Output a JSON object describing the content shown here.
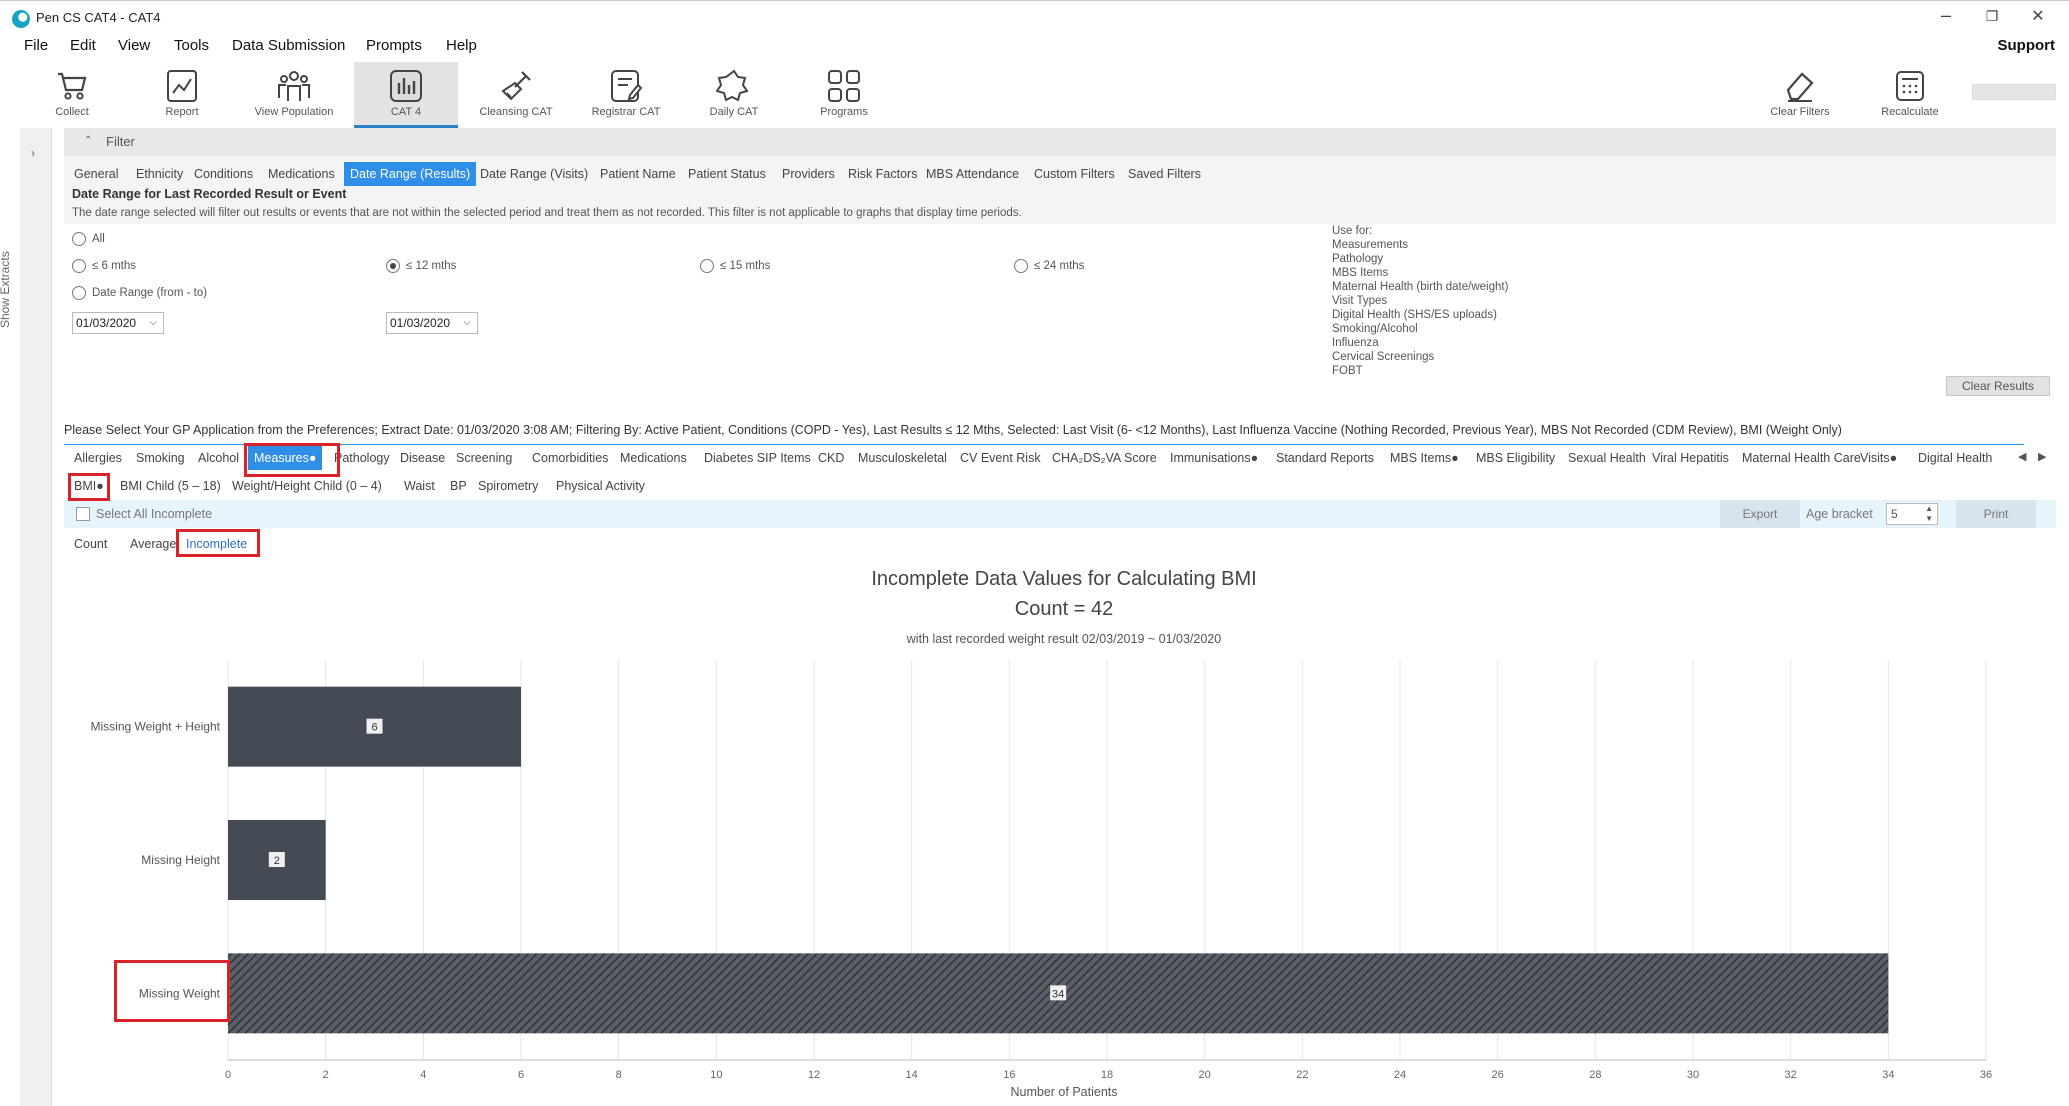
{
  "window": {
    "title": "Pen CS CAT4 - CAT4",
    "controls": [
      "–",
      "❐",
      "✕"
    ]
  },
  "menu": {
    "items": [
      "File",
      "Edit",
      "View",
      "Tools",
      "Data Submission",
      "Prompts",
      "Help"
    ],
    "support": "Support"
  },
  "toolbar": {
    "items": [
      {
        "label": "Collect",
        "icon": "cart-icon"
      },
      {
        "label": "Report",
        "icon": "report-chart-icon"
      },
      {
        "label": "View Population",
        "icon": "population-icon"
      },
      {
        "label": "CAT 4",
        "icon": "bar-chart-icon"
      },
      {
        "label": "Cleansing CAT",
        "icon": "broom-icon"
      },
      {
        "label": "Registrar CAT",
        "icon": "registrar-icon"
      },
      {
        "label": "Daily CAT",
        "icon": "daily-icon"
      },
      {
        "label": "Programs",
        "icon": "grid-icon"
      }
    ],
    "right": [
      {
        "label": "Clear Filters",
        "icon": "eraser-icon"
      },
      {
        "label": "Recalculate",
        "icon": "calculator-icon"
      }
    ]
  },
  "sidebar": {
    "label": "Show Extracts"
  },
  "filter": {
    "header": "Filter",
    "tabs": [
      "General",
      "Ethnicity",
      "Conditions",
      "Medications",
      "Date Range (Results)",
      "Date Range (Visits)",
      "Patient Name",
      "Patient Status",
      "Providers",
      "Risk Factors",
      "MBS Attendance",
      "Custom Filters",
      "Saved Filters"
    ],
    "selected_tab": "Date Range (Results)",
    "heading": "Date Range for Last Recorded Result or Event",
    "description": "The date range selected will filter out results or events that are not within the selected period and treat them as not recorded. This filter is not applicable to graphs that display time periods.",
    "options": {
      "all": "All",
      "m6": "≤ 6 mths",
      "m12": "≤ 12 mths",
      "m15": "≤ 15 mths",
      "m24": "≤ 24 mths",
      "range": "Date Range (from - to)"
    },
    "selected_option": "≤ 12 mths",
    "date_from": "01/03/2020",
    "date_to": "01/03/2020",
    "use_for_title": "Use for:",
    "use_for": [
      "Measurements",
      "Pathology",
      "MBS Items",
      "Maternal Health (birth date/weight)",
      "Visit Types",
      "Digital Health (SHS/ES uploads)",
      "Smoking/Alcohol",
      "Influenza",
      "Cervical Screenings",
      "FOBT"
    ],
    "clear_results": "Clear Results"
  },
  "status": "Please Select Your GP Application from the Preferences; Extract Date: 01/03/2020 3:08 AM; Filtering By: Active Patient, Conditions (COPD - Yes), Last Results ≤ 12 Mths, Selected: Last Visit (6- <12 Months), Last Influenza Vaccine (Nothing Recorded, Previous Year), MBS Not Recorded (CDM Review), BMI (Weight Only)",
  "result_tabs": [
    "Allergies",
    "Smoking",
    "Alcohol",
    "Measures●",
    "Pathology",
    "Disease",
    "Screening",
    "Comorbidities",
    "Medications",
    "Diabetes SIP Items",
    "CKD",
    "Musculoskeletal",
    "CV Event Risk",
    "CHA₂DS₂VA Score",
    "Immunisations●",
    "Standard Reports",
    "MBS Items●",
    "MBS Eligibility",
    "Sexual Health",
    "Viral Hepatitis",
    "Maternal Health Care",
    "Visits●",
    "Digital Health"
  ],
  "result_tab_selected": "Measures●",
  "sub_tabs": [
    "BMI●",
    "BMI Child (5 – 18)",
    "Weight/Height Child (0 – 4)",
    "Waist",
    "BP",
    "Spirometry",
    "Physical Activity"
  ],
  "actions": {
    "select_all": "Select All Incomplete",
    "export": "Export",
    "age_bracket_label": "Age bracket",
    "age_bracket_value": "5",
    "print": "Print"
  },
  "view_tabs": [
    "Count",
    "Average",
    "Incomplete"
  ],
  "view_selected": "Incomplete",
  "chart_data": {
    "type": "bar",
    "orientation": "horizontal",
    "title": "Incomplete Data Values for Calculating BMI",
    "subtitle": "Count = 42",
    "note": "with last recorded weight result 02/03/2019 ~ 01/03/2020",
    "categories": [
      "Missing Weight + Height",
      "Missing Height",
      "Missing Weight"
    ],
    "values": [
      6,
      2,
      34
    ],
    "colors": [
      "#454b55",
      "#454b55",
      "hatched"
    ],
    "xlabel": "Number of Patients",
    "xlim": [
      0,
      36
    ],
    "xticks": [
      0,
      2,
      4,
      6,
      8,
      10,
      12,
      14,
      16,
      18,
      20,
      22,
      24,
      26,
      28,
      30,
      32,
      34,
      36
    ],
    "grid": true
  }
}
